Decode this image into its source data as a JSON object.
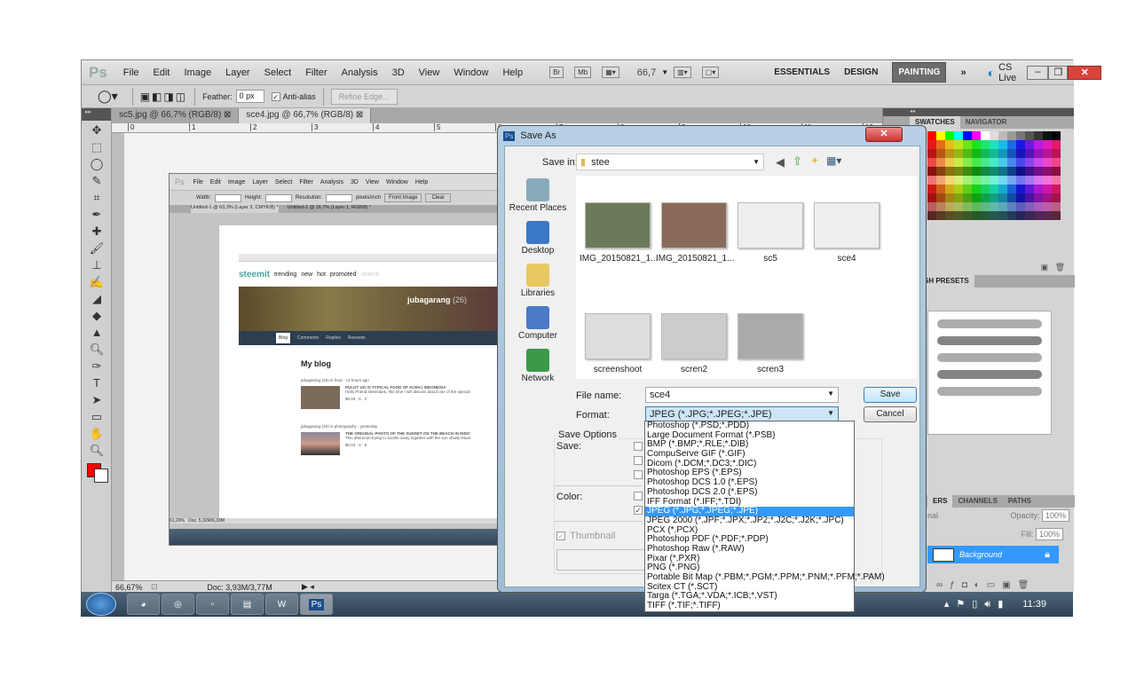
{
  "app": {
    "logo": "Ps",
    "menu": [
      "File",
      "Edit",
      "Image",
      "Layer",
      "Select",
      "Filter",
      "Analysis",
      "3D",
      "View",
      "Window",
      "Help"
    ],
    "bridge": "Br",
    "minibridge": "Mb",
    "zoom": "66,7",
    "workspaces": [
      "ESSENTIALS",
      "DESIGN",
      "PAINTING"
    ],
    "active_workspace": "PAINTING",
    "cslive": "CS Live"
  },
  "options": {
    "feather_label": "Feather:",
    "feather_value": "0 px",
    "antialias_label": "Anti-alias",
    "antialias_checked": true,
    "refine_edge": "Refine Edge..."
  },
  "tabs": [
    {
      "label": "sc5.jpg @ 66,7% (RGB/8)",
      "active": false
    },
    {
      "label": "sce4.jpg @ 66,7% (RGB/8)",
      "active": true
    }
  ],
  "ruler": [
    "0",
    "1",
    "2",
    "3",
    "4",
    "5",
    "6",
    "7",
    "8",
    "9",
    "10",
    "11",
    "12"
  ],
  "status": {
    "zoom": "66,67%",
    "doc": "Doc: 3,93M/3,77M"
  },
  "inner": {
    "menu": [
      "File",
      "Edit",
      "Image",
      "Layer",
      "Select",
      "Filter",
      "Analysis",
      "3D",
      "View",
      "Window",
      "Help"
    ],
    "width_label": "Width:",
    "height_label": "Height:",
    "resolution_label": "Resolution:",
    "unit": "pixels/inch",
    "front_image": "Front Image",
    "clear": "Clear",
    "tabs": [
      "Untitled-1 @ 63,3% (Layer 3, CMYK/8) *",
      "Untitled-2 @ 16,7% (Layer 1, RGB/8) *"
    ],
    "status_zoom": "61,29%",
    "status_doc": "Doc: 5,32M/6,33M",
    "site": {
      "logo": "steemit",
      "nav": [
        "trending",
        "new",
        "hot",
        "promoted"
      ],
      "search": "search",
      "user": "jubagarang",
      "rep": "(26)",
      "profile_tabs": [
        "Blog",
        "Comments",
        "Replies",
        "Rewards"
      ],
      "section": "My blog",
      "posts": [
        {
          "author": "jubagarang (26) in food · 14 hours ago",
          "title": "PULOT UO IS TYPICAL FOOD OF ACEH | INDONESIA",
          "excerpt": "Hello Friend steemians, this time I will discuss about one of the special",
          "payout": "$0.03",
          "votes": "5",
          "comments": "2"
        },
        {
          "author": "jubagarang (26) in photography · yesterday",
          "title": "THE ORIGINAL PHOTO OF THE SUNSET ON THE BEACH IN INDO",
          "excerpt": "This afternoon trying to soothe away together with the sun slowly leave",
          "payout": "$0.03",
          "votes": "6",
          "comments": "9"
        }
      ]
    }
  },
  "panels": {
    "swatches": "SWATCHES",
    "navigator": "NAVIGATOR",
    "brush_presets": "SH PRESETS",
    "layers": "ERS",
    "channels": "CHANNELS",
    "paths": "PATHS",
    "blend": "nal",
    "opacity_label": "Opacity:",
    "opacity": "100%",
    "fill_label": "Fill:",
    "fill": "100%",
    "layer_name": "Background"
  },
  "dialog": {
    "title": "Save As",
    "save_in_label": "Save in:",
    "save_in": "stee",
    "places": [
      "Recent Places",
      "Desktop",
      "Libraries",
      "Computer",
      "Network"
    ],
    "files": [
      "IMG_20150821_1...",
      "IMG_20150821_1...",
      "sc5",
      "sce4",
      "screenshoot",
      "scren2",
      "scren3"
    ],
    "file_name_label": "File name:",
    "file_name": "sce4",
    "format_label": "Format:",
    "format": "JPEG (*.JPG;*.JPEG;*.JPE)",
    "save": "Save",
    "cancel": "Cancel",
    "save_options": "Save Options",
    "save_label": "Save:",
    "color_label": "Color:",
    "thumbnail": "Thumbnail",
    "formats": [
      "Photoshop (*.PSD;*.PDD)",
      "Large Document Format (*.PSB)",
      "BMP (*.BMP;*.RLE;*.DIB)",
      "CompuServe GIF (*.GIF)",
      "Dicom (*.DCM;*.DC3;*.DIC)",
      "Photoshop EPS (*.EPS)",
      "Photoshop DCS 1.0 (*.EPS)",
      "Photoshop DCS 2.0 (*.EPS)",
      "IFF Format (*.IFF;*.TDI)",
      "JPEG (*.JPG;*.JPEG;*.JPE)",
      "JPEG 2000 (*.JPF;*.JPX;*.JP2;*.J2C;*.J2K;*.JPC)",
      "PCX (*.PCX)",
      "Photoshop PDF (*.PDF;*.PDP)",
      "Photoshop Raw (*.RAW)",
      "Pixar (*.PXR)",
      "PNG (*.PNG)",
      "Portable Bit Map (*.PBM;*.PGM;*.PPM;*.PNM;*.PFM;*.PAM)",
      "Scitex CT (*.SCT)",
      "Targa (*.TGA;*.VDA;*.ICB;*.VST)",
      "TIFF (*.TIF;*.TIFF)"
    ],
    "selected_format_index": 9
  },
  "taskbar": {
    "clock": "11:39",
    "apps": [
      "chrome",
      "network",
      "explorer-window",
      "libraries",
      "word",
      "photoshop"
    ]
  },
  "colors": {
    "foreground": "#ff0000",
    "selection": "#3399ff",
    "layer_selected": "#3399ff",
    "workspace_active": "#6c6c6c"
  }
}
